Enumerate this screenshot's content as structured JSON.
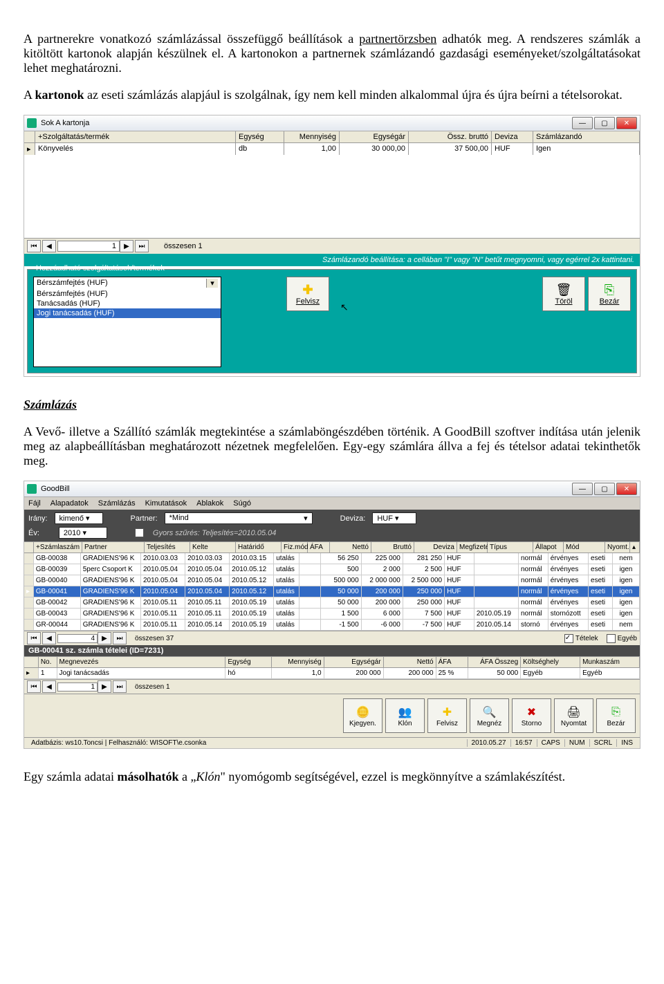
{
  "para1": {
    "t1": "A partnerekre vonatkozó számlázással összefüggő beállítások a ",
    "t2": "partnertörzsben",
    "t3": " adhatók meg. A rendszeres számlák a kitöltött kartonok alapján készülnek el. A kartonokon a partnernek számlázandó gazdasági eseményeket/szolgáltatásokat lehet meghatározni."
  },
  "para2": {
    "t1": " A ",
    "t2": "kartonok",
    "t3": " az eseti számlázás alapjául is szolgálnak, így nem kell minden alkalommal újra és újra beírni a tételsorokat."
  },
  "app1": {
    "title": "Sok A kartonja",
    "cols": [
      "+Szolgáltatás/termék",
      "Egység",
      "Mennyiség",
      "Egységár",
      "Össz. bruttó",
      "Deviza",
      "Számlázandó"
    ],
    "row": [
      "Könyvelés",
      "db",
      "1,00",
      "30 000,00",
      "37 500,00",
      "HUF",
      "Igen"
    ],
    "pager_val": "1",
    "pager_total": "összesen 1",
    "hint": "Számlázandó beállítása: a cellában \"I\" vagy \"N\" betűt megnyomni, vagy egérrel 2x kattintani.",
    "fieldset": "Hozzáadható szolgáltatások/termékek",
    "combo_selected": "Bérszámfejtés (HUF)",
    "combo_items": [
      "Bérszámfejtés (HUF)",
      "Tanácsadás (HUF)",
      "Jogi tanácsadás (HUF)"
    ],
    "btn_add": "Felvisz",
    "btn_del": "Töröl",
    "btn_close": "Bezár"
  },
  "sec2": {
    "heading": "Számlázás",
    "para": "A Vevő- illetve a Szállító számlák megtekintése a számlaböngészdében történik. A GoodBill szoftver indítása után jelenik meg az alapbeállításban meghatározott nézetnek megfelelően. Egy-egy számlára állva a fej és tételsor adatai tekinthetők meg."
  },
  "app2": {
    "title": "GoodBill",
    "menu": [
      "Fájl",
      "Alapadatok",
      "Számlázás",
      "Kimutatások",
      "Ablakok",
      "Súgó"
    ],
    "filters": {
      "irany_l": "Irány:",
      "irany_v": "kimenő",
      "ev_l": "Év:",
      "ev_v": "2010",
      "partner_l": "Partner:",
      "partner_v": "*Mind",
      "deviza_l": "Deviza:",
      "deviza_v": "HUF",
      "gyors": "Gyors szűrés: Teljesítés=2010.05.04"
    },
    "cols": [
      "+Számlaszám",
      "Partner",
      "Teljesítés",
      "Kelte",
      "Határidő",
      "Fiz.mód",
      "ÁFA",
      "Nettó",
      "Bruttó",
      "Deviza",
      "Megfizetés",
      "Típus",
      "Állapot",
      "Mód",
      "Nyomt."
    ],
    "rows": [
      [
        "GB-00038",
        "GRADIENS'96 K",
        "2010.03.03",
        "2010.03.03",
        "2010.03.15",
        "utalás",
        "",
        "56 250",
        "225 000",
        "281 250",
        "HUF",
        "",
        "normál",
        "érvényes",
        "eseti",
        "nem"
      ],
      [
        "GB-00039",
        "5perc Csoport K",
        "2010.05.04",
        "2010.05.04",
        "2010.05.12",
        "utalás",
        "",
        "500",
        "2 000",
        "2 500",
        "HUF",
        "",
        "normál",
        "érvényes",
        "eseti",
        "igen"
      ],
      [
        "GB-00040",
        "GRADIENS'96 K",
        "2010.05.04",
        "2010.05.04",
        "2010.05.12",
        "utalás",
        "",
        "500 000",
        "2 000 000",
        "2 500 000",
        "HUF",
        "",
        "normál",
        "érvényes",
        "eseti",
        "igen"
      ],
      [
        "GB-00041",
        "GRADIENS'96 K",
        "2010.05.04",
        "2010.05.04",
        "2010.05.12",
        "utalás",
        "",
        "50 000",
        "200 000",
        "250 000",
        "HUF",
        "",
        "normál",
        "érvényes",
        "eseti",
        "igen"
      ],
      [
        "GB-00042",
        "GRADIENS'96 K",
        "2010.05.11",
        "2010.05.11",
        "2010.05.19",
        "utalás",
        "",
        "50 000",
        "200 000",
        "250 000",
        "HUF",
        "",
        "normál",
        "érvényes",
        "eseti",
        "igen"
      ],
      [
        "GB-00043",
        "GRADIENS'96 K",
        "2010.05.11",
        "2010.05.11",
        "2010.05.19",
        "utalás",
        "",
        "1 500",
        "6 000",
        "7 500",
        "HUF",
        "2010.05.19",
        "normál",
        "stornózott",
        "eseti",
        "igen"
      ],
      [
        "GR-00044",
        "GRADIENS'96 K",
        "2010.05.11",
        "2010.05.14",
        "2010.05.19",
        "utalás",
        "",
        "-1 500",
        "-6 000",
        "-7 500",
        "HUF",
        "2010.05.14",
        "stornó",
        "érvényes",
        "eseti",
        "nem"
      ]
    ],
    "selected": 3,
    "pager_val": "4",
    "pager_total": "összesen 37",
    "chk1": "Tételek",
    "chk2": "Egyéb",
    "detail_title": "GB-00041 sz. számla tételei (ID=7231)",
    "dcols": [
      "No.",
      "Megnevezés",
      "Egység",
      "Mennyiség",
      "Egységár",
      "Nettó",
      "ÁFA",
      "ÁFA Összeg",
      "Költséghely",
      "Munkaszám"
    ],
    "drow": [
      "1",
      "Jogi tanácsadás",
      "hó",
      "1,0",
      "200 000",
      "200 000",
      "25 %",
      "50 000",
      "Egyéb",
      "Egyéb"
    ],
    "dpager_val": "1",
    "dpager_total": "összesen 1",
    "buttons": [
      "Kjegyen.",
      "Klón",
      "Felvisz",
      "Megnéz",
      "Storno",
      "Nyomtat",
      "Bezár"
    ],
    "status_db": "Adatbázis: ws10.Toncsi | Felhasználó: WISOFT\\e.csonka",
    "status_date": "2010.05.27",
    "status_time": "16:57",
    "status_caps": "CAPS",
    "status_num": "NUM",
    "status_scrl": "SCRL",
    "status_ins": "INS"
  },
  "para3": {
    "t1": "Egy számla adatai ",
    "t2": "másolhatók",
    "t3": " a „",
    "t4": "Klón",
    "t5": "\" nyomógomb segítségével, ezzel is megkönnyítve a számlakészítést."
  }
}
